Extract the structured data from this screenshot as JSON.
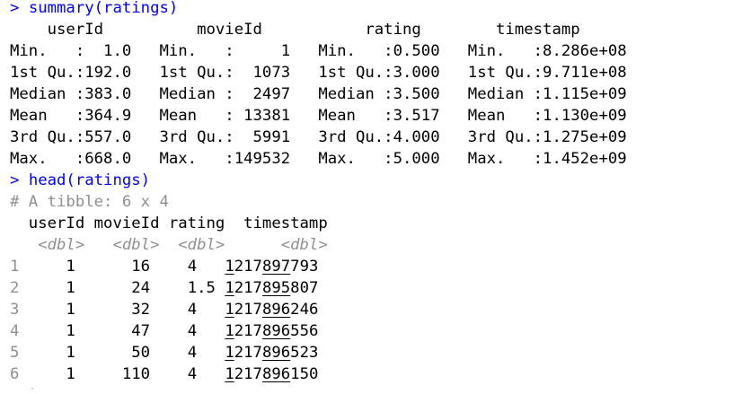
{
  "console": {
    "prompt": "> ",
    "commands": {
      "summary": "summary(ratings)",
      "head": "head(ratings)"
    },
    "summary_header": "    userId          movieId           rating        timestamp",
    "summary_rows": [
      "Min.   :  1.0   Min.   :     1   Min.   :0.500   Min.   :8.286e+08",
      "1st Qu.:192.0   1st Qu.:  1073   1st Qu.:3.000   1st Qu.:9.711e+08",
      "Median :383.0   Median :  2497   Median :3.500   Median :1.115e+09",
      "Mean   :364.9   Mean   : 13381   Mean   :3.517   Mean   :1.130e+09",
      "3rd Qu.:557.0   3rd Qu.:  5991   3rd Qu.:4.000   3rd Qu.:1.275e+09",
      "Max.   :668.0   Max.   :149532   Max.   :5.000   Max.   :1.452e+09"
    ],
    "tibble_comment": "# A tibble: 6 x 4",
    "tibble_header": "  userId movieId rating  timestamp",
    "tibble_types": "   <dbl>   <dbl>  <dbl>      <dbl>",
    "tibble_rows": [
      {
        "num": "1",
        "user": "     1",
        "movie": "      16",
        "rating": "    4  ",
        "ts_a": "1",
        "ts_b": "217",
        "ts_c": "897",
        "ts_d": "793"
      },
      {
        "num": "2",
        "user": "     1",
        "movie": "      24",
        "rating": "    1.5",
        "ts_a": "1",
        "ts_b": "217",
        "ts_c": "895",
        "ts_d": "807"
      },
      {
        "num": "3",
        "user": "     1",
        "movie": "      32",
        "rating": "    4  ",
        "ts_a": "1",
        "ts_b": "217",
        "ts_c": "896",
        "ts_d": "246"
      },
      {
        "num": "4",
        "user": "     1",
        "movie": "      47",
        "rating": "    4  ",
        "ts_a": "1",
        "ts_b": "217",
        "ts_c": "896",
        "ts_d": "556"
      },
      {
        "num": "5",
        "user": "     1",
        "movie": "      50",
        "rating": "    4  ",
        "ts_a": "1",
        "ts_b": "217",
        "ts_c": "896",
        "ts_d": "523"
      },
      {
        "num": "6",
        "user": "     1",
        "movie": "     110",
        "rating": "    4  ",
        "ts_a": "1",
        "ts_b": "217",
        "ts_c": "896",
        "ts_d": "150"
      }
    ]
  }
}
